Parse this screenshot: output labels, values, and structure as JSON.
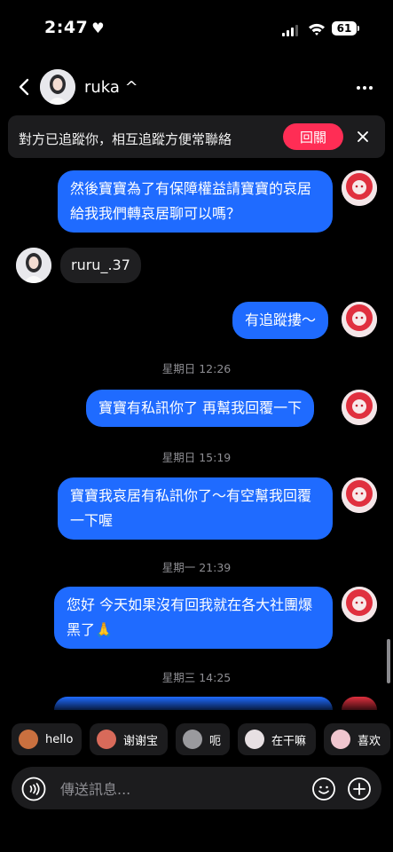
{
  "status_bar": {
    "time": "2:47",
    "battery": "61"
  },
  "header": {
    "name": "ruka ^"
  },
  "banner": {
    "text": "對方已追蹤你，相互追蹤方便常聯絡",
    "follow_label": "回關"
  },
  "messages": [
    {
      "id": "m1",
      "text": "然後寶寶為了有保障權益請寶寶的哀居給我我們轉哀居聊可以嗎？",
      "from": "me"
    },
    {
      "id": "m2",
      "text": "ruru_.37",
      "from": "them"
    },
    {
      "id": "m3",
      "text": "有追蹤摟～",
      "from": "me"
    },
    {
      "id": "t1",
      "timestamp": "星期日 12:26"
    },
    {
      "id": "m4",
      "text": "寶寶有私訊你了 再幫我回覆一下",
      "from": "me"
    },
    {
      "id": "t2",
      "timestamp": "星期日 15:19"
    },
    {
      "id": "m5",
      "text": "寶寶我哀居有私訊你了～有空幫我回覆一下喔",
      "from": "me"
    },
    {
      "id": "t3",
      "timestamp": "星期一 21:39"
    },
    {
      "id": "m6",
      "text": "您好 今天如果沒有回我就在各大社團爆黑了🙏",
      "from": "me"
    },
    {
      "id": "t4",
      "timestamp": "星期三 14:25"
    }
  ],
  "stickers": [
    {
      "label": "hello",
      "icon": "monkey-sticker-icon"
    },
    {
      "label": "谢谢宝",
      "icon": "thanks-sticker-icon"
    },
    {
      "label": "呃",
      "icon": "cat-sticker-icon"
    },
    {
      "label": "在干嘛",
      "icon": "bear-sticker-icon"
    },
    {
      "label": "喜欢",
      "icon": "love-sticker-icon"
    }
  ],
  "input": {
    "placeholder": "傳送訊息..."
  },
  "colors": {
    "bubble": "#1f6bff",
    "follow_button": "#ff2d55",
    "background": "#000000"
  }
}
